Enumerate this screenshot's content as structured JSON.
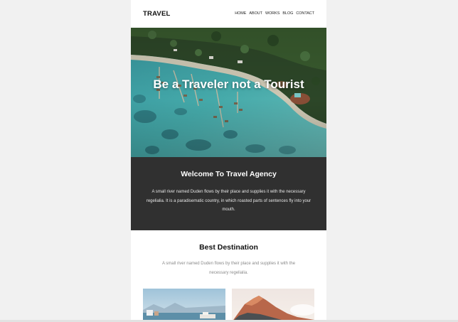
{
  "header": {
    "brand": "TRAVEL",
    "nav": [
      "HOME",
      "ABOUT",
      "WORKS",
      "BLOG",
      "CONTACT"
    ]
  },
  "hero": {
    "title": "Be a Traveler not a Tourist"
  },
  "welcome": {
    "title": "Welcome To Travel Agency",
    "text": "A small river named Duden flows by their place and supplies it with the necessary regelialia. It is a paradisematic country, in which roasted parts of sentences fly into your mouth."
  },
  "destination": {
    "title": "Best Destination",
    "text": "A small river named Duden flows by their place and supplies it with the necessary regelialia."
  },
  "colors": {
    "page_background": "#f1f1f1",
    "welcome_background": "#303030",
    "lagoon": "#4fb3b5"
  }
}
